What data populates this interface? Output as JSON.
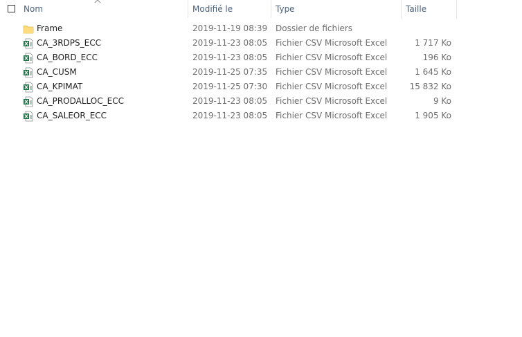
{
  "header": {
    "columns": [
      {
        "label": "Nom"
      },
      {
        "label": "Modifié le"
      },
      {
        "label": "Type"
      },
      {
        "label": "Taille"
      }
    ],
    "sort_indicator": "sort-ascending-icon"
  },
  "colors": {
    "header_text": "#4c607a",
    "name_text": "#1f1f1f",
    "detail_text": "#6d6d6d",
    "folder": "#f8d775",
    "excel_green": "#1e7145"
  },
  "files": [
    {
      "name": "Frame",
      "date": "2019-11-19 08:39",
      "type": "Dossier de fichiers",
      "size": "",
      "icon": "folder-icon"
    },
    {
      "name": "CA_3RDPS_ECC",
      "date": "2019-11-23 08:05",
      "type": "Fichier CSV Microsoft Excel",
      "size": "1 717 Ko",
      "icon": "excel-csv-icon"
    },
    {
      "name": "CA_BORD_ECC",
      "date": "2019-11-23 08:05",
      "type": "Fichier CSV Microsoft Excel",
      "size": "196 Ko",
      "icon": "excel-csv-icon"
    },
    {
      "name": "CA_CUSM",
      "date": "2019-11-25 07:35",
      "type": "Fichier CSV Microsoft Excel",
      "size": "1 645 Ko",
      "icon": "excel-csv-icon"
    },
    {
      "name": "CA_KPIMAT",
      "date": "2019-11-25 07:30",
      "type": "Fichier CSV Microsoft Excel",
      "size": "15 832 Ko",
      "icon": "excel-csv-icon"
    },
    {
      "name": "CA_PRODALLOC_ECC",
      "date": "2019-11-23 08:05",
      "type": "Fichier CSV Microsoft Excel",
      "size": "9 Ko",
      "icon": "excel-csv-icon"
    },
    {
      "name": "CA_SALEOR_ECC",
      "date": "2019-11-23 08:05",
      "type": "Fichier CSV Microsoft Excel",
      "size": "1 905 Ko",
      "icon": "excel-csv-icon"
    }
  ]
}
